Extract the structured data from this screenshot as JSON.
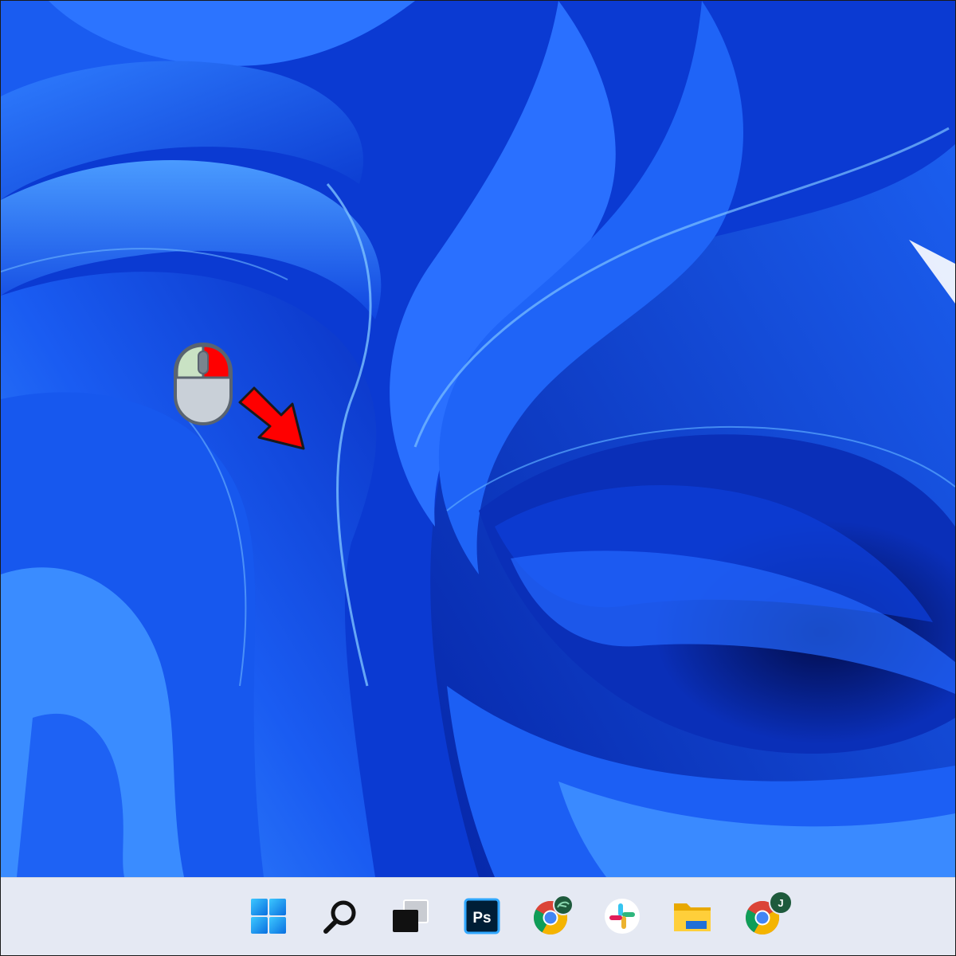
{
  "wallpaper": {
    "name": "windows-11-bloom-wallpaper",
    "colors": {
      "deep": "#0a2fb8",
      "mid": "#1357f0",
      "light": "#3a8cff",
      "highlight": "#6fb6ff",
      "dark": "#041a7a"
    }
  },
  "annotation": {
    "mouse_icon": "mouse-right-click-icon",
    "arrow_icon": "red-arrow-icon",
    "arrow_color": "#ff0000",
    "right_button_color": "#ff0000",
    "left_button_color": "#c9e2c4",
    "body_color": "#c9d0d8"
  },
  "taskbar": {
    "background": "#e5e9f3",
    "items": [
      {
        "name": "start-button",
        "icon": "windows-logo-icon"
      },
      {
        "name": "search-button",
        "icon": "magnifier-icon"
      },
      {
        "name": "task-view-button",
        "icon": "task-view-icon"
      },
      {
        "name": "photoshop-app",
        "icon": "photoshop-icon",
        "label": "Ps"
      },
      {
        "name": "chrome-app-profile-1",
        "icon": "chrome-icon"
      },
      {
        "name": "slack-app",
        "icon": "slack-icon"
      },
      {
        "name": "file-explorer-app",
        "icon": "folder-icon"
      },
      {
        "name": "chrome-app-profile-2",
        "icon": "chrome-icon",
        "badge": "J"
      }
    ]
  }
}
